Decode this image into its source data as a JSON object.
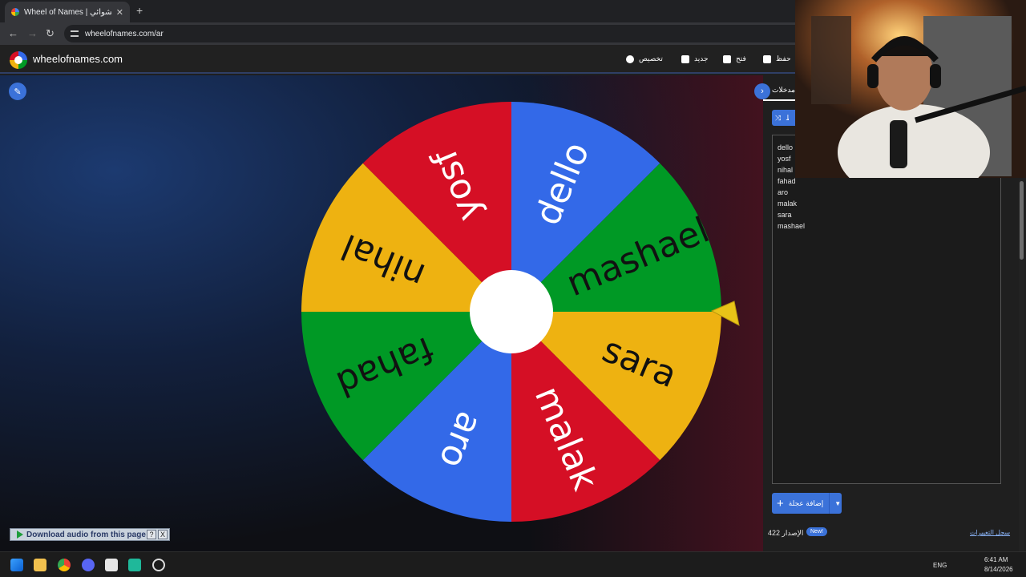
{
  "browser": {
    "tab_title": "Wheel of Names | سم العشوائي",
    "tab_close": "✕",
    "new_tab": "+",
    "url": "wheelofnames.com/ar"
  },
  "app": {
    "brand": "wheelofnames.com",
    "menu": {
      "customize": "تخصيص",
      "new": "جديد",
      "open": "فتح",
      "save": "حفظ"
    }
  },
  "wheel": {
    "segments": [
      "dello",
      "mashael",
      "sara",
      "malak",
      "aro",
      "fahad",
      "nihal",
      "yosf"
    ],
    "colors": [
      "#3369e8",
      "#009925",
      "#eeb211",
      "#d50f25"
    ]
  },
  "side_panel": {
    "entries_tab": "مدخلات",
    "shuffle_label": "خلط",
    "entries": [
      "dello",
      "yosf",
      "nihal",
      "fahad",
      "aro",
      "malak",
      "sara",
      "mashael"
    ],
    "add_image": "إضافة عجلة",
    "version": "الإصدار 422",
    "new_badge": "New!",
    "changelog": "سجل التغييرات"
  },
  "download_bar": {
    "label": "Download audio from this page",
    "help": "?",
    "close": "X"
  },
  "taskbar": {
    "language": "ENG",
    "time": "6:41 AM",
    "date": "8/14/2026"
  }
}
